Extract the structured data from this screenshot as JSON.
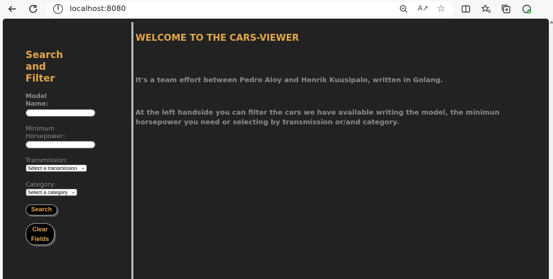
{
  "browser": {
    "url": "localhost:8080"
  },
  "sidebar": {
    "title": "Search and Filter",
    "model_label": "Model Name:",
    "model_value": "",
    "horsepower_label": "Minimum Horsepower:",
    "horsepower_value": "",
    "transmission_label": "Transmission:",
    "transmission_selected": "Select a transmission",
    "category_label": "Category:",
    "category_selected": "Select a category",
    "search_button": "Search",
    "clear_button_line1": "Clear",
    "clear_button_line2": "Fields"
  },
  "main": {
    "heading": "WELCOME TO THE CARS-VIEWER",
    "paragraph1": "It's a team effort between Pedro Aloy and Henrik Kuusipalo, written in Golang.",
    "paragraph2": "At the left handside you can filter the cars we have available writing the model, the minimun horsepower you need or selecting by transmission or/and category."
  },
  "colors": {
    "accent": "#e3a74c",
    "page_bg": "#222222",
    "text_muted": "#8b8b8b"
  }
}
